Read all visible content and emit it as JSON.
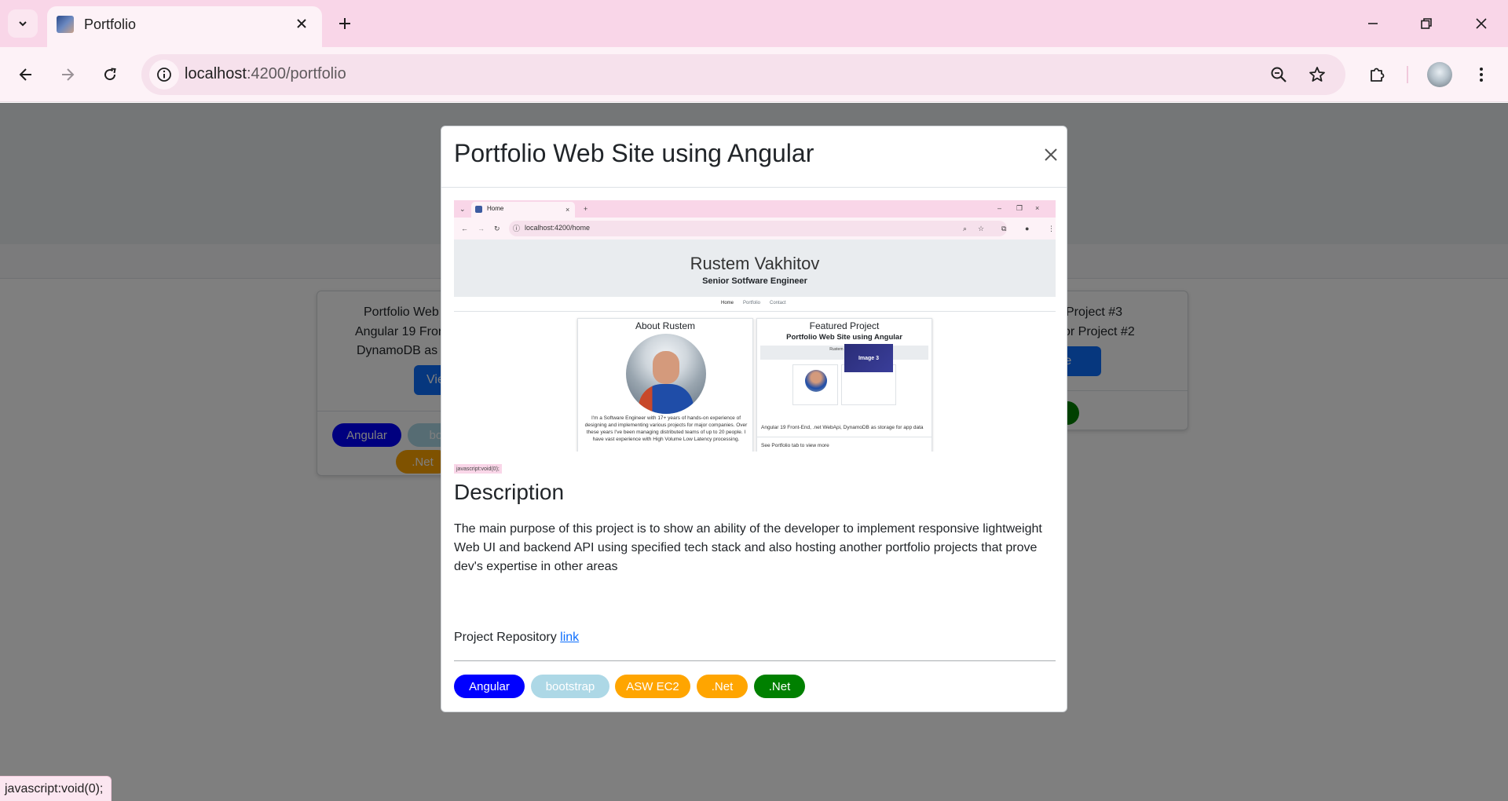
{
  "browser": {
    "tab_title": "Portfolio",
    "url_host": "localhost",
    "url_path": ":4200/portfolio"
  },
  "background_page": {
    "left_card": {
      "title": "Portfolio Web",
      "text_line1": "Angular 19 Fron",
      "text_line2": "DynamoDB as s",
      "button": "Vie",
      "tags": [
        {
          "label": "Angular",
          "color": "#0000ff"
        },
        {
          "label": "boo",
          "color": "#add8e6"
        },
        {
          "label": ".Net",
          "color": "#ffa500"
        }
      ]
    },
    "right_card": {
      "title": "Project #3",
      "text": "or Project #2",
      "button": "re"
    }
  },
  "modal": {
    "title": "Portfolio Web Site using Angular",
    "screenshot": {
      "tab_title": "Home",
      "url": "localhost:4200/home",
      "name": "Rustem Vakhitov",
      "role": "Senior Sotfware Engineer",
      "nav": [
        "Home",
        "Portfolio",
        "Contact"
      ],
      "about_title": "About Rustem",
      "about_text": "I'm a Software Engineer with 17+ years of hands-on experience of designing and implementing various projects for major companies. Over these years I've been managing distributed teams of up to 20 people. I have vast experience with High Volume Low Latency processing.",
      "featured_title": "Featured Project",
      "featured_subtitle": "Portfolio Web Site using Angular",
      "inner_name": "Rustem Vakhitov",
      "inner_image_label": "Image 3",
      "featured_text": "Angular 19 Front-End, .net WebApi, DynamoDB as storage for app data",
      "featured_footer": "See Portfolio tab to view more"
    },
    "caption": "javascript:void(0);",
    "description_title": "Description",
    "description_text": "The main purpose of this project is to show an ability of the developer to implement responsive lightweight Web UI and backend API using specified tech stack and also hosting another portfolio projects that prove dev's expertise in other areas",
    "repo_label": "Project Repository",
    "repo_link": "link",
    "tags": [
      {
        "label": "Angular",
        "color": "#0000ff"
      },
      {
        "label": "bootstrap",
        "color": "#add8e6"
      },
      {
        "label": "ASW EC2",
        "color": "#ffa500"
      },
      {
        "label": ".Net",
        "color": "#ffa500"
      },
      {
        "label": ".Net",
        "color": "#008000"
      }
    ]
  },
  "status_bar": "javascript:void(0);"
}
